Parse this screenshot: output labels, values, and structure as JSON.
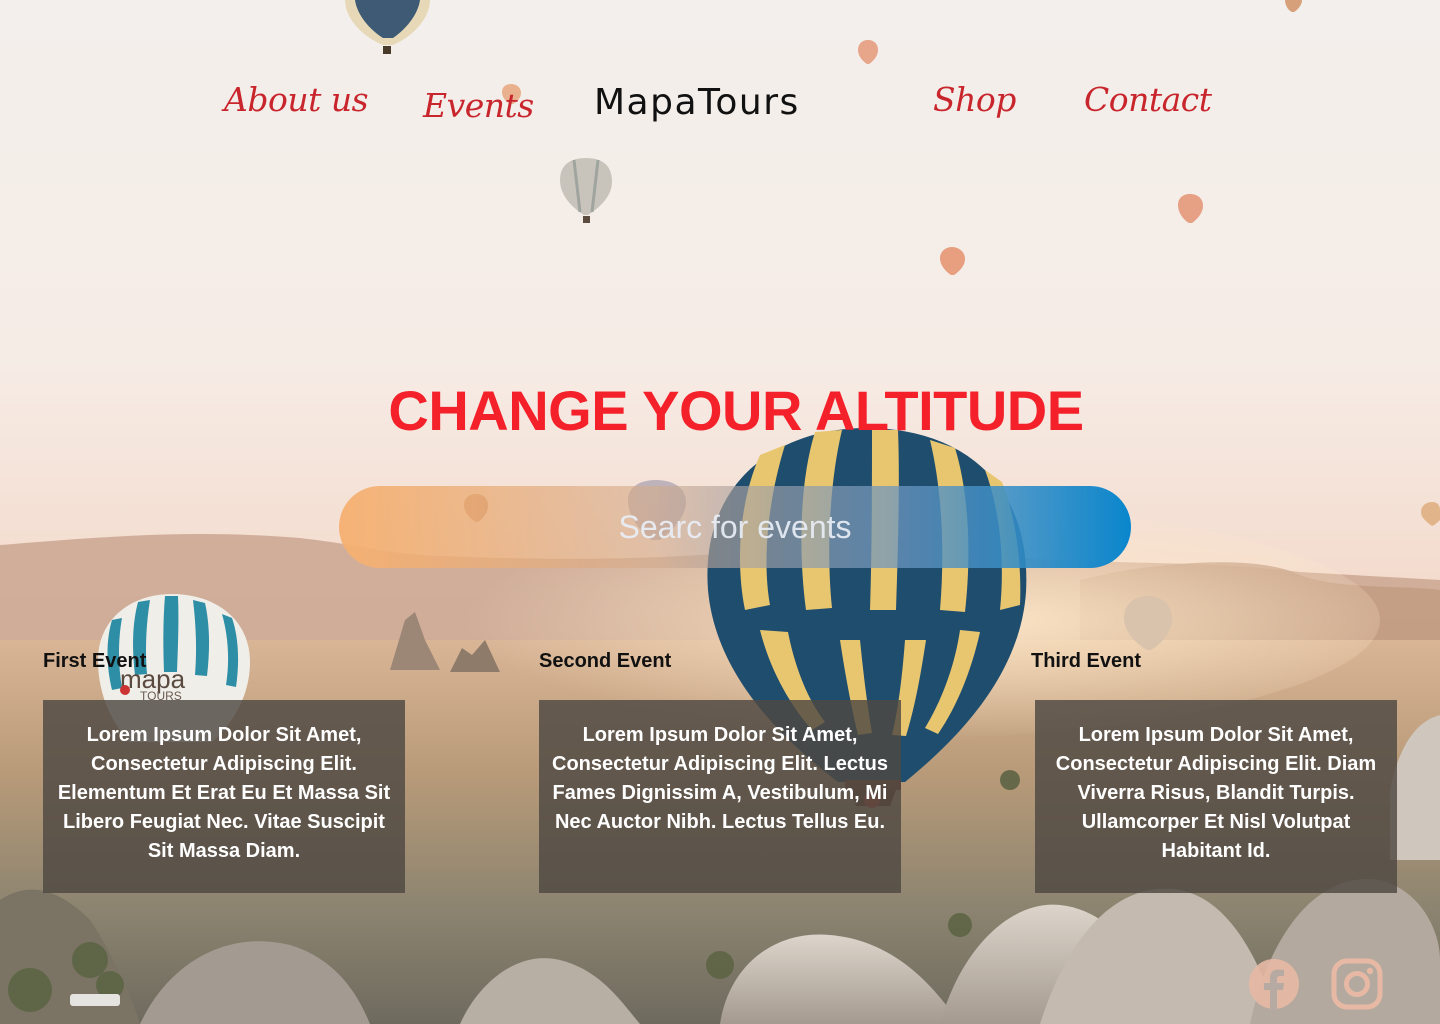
{
  "nav": {
    "about": "About us",
    "events": "Events",
    "logo": "MapaTours",
    "shop": "Shop",
    "contact": "Contact"
  },
  "hero": {
    "title": "CHANGE YOUR ALTITUDE"
  },
  "search": {
    "placeholder": "Searc for events"
  },
  "events": [
    {
      "label": "First Event",
      "text": "Lorem Ipsum Dolor Sit Amet, Consectetur Adipiscing Elit. Elementum Et Erat Eu Et Massa Sit Libero Feugiat Nec. Vitae Suscipit Sit Massa Diam."
    },
    {
      "label": "Second  Event",
      "text": "Lorem Ipsum Dolor Sit Amet, Consectetur Adipiscing Elit. Lectus Fames Dignissim A, Vestibulum, Mi Nec Auctor Nibh. Lectus Tellus Eu."
    },
    {
      "label": "Third Event",
      "text": "Lorem Ipsum Dolor Sit Amet, Consectetur Adipiscing Elit. Diam Viverra Risus, Blandit Turpis. Ullamcorper Et Nisl Volutpat Habitant Id."
    }
  ],
  "balloon_text": {
    "brand": "mapa",
    "brand_sub": "TOURS"
  },
  "social": [
    "facebook-icon",
    "instagram-icon"
  ],
  "colors": {
    "accent": "#f4212a",
    "nav": "#c8252c",
    "search_end": "#0a86cc",
    "card": "#4e4842"
  }
}
